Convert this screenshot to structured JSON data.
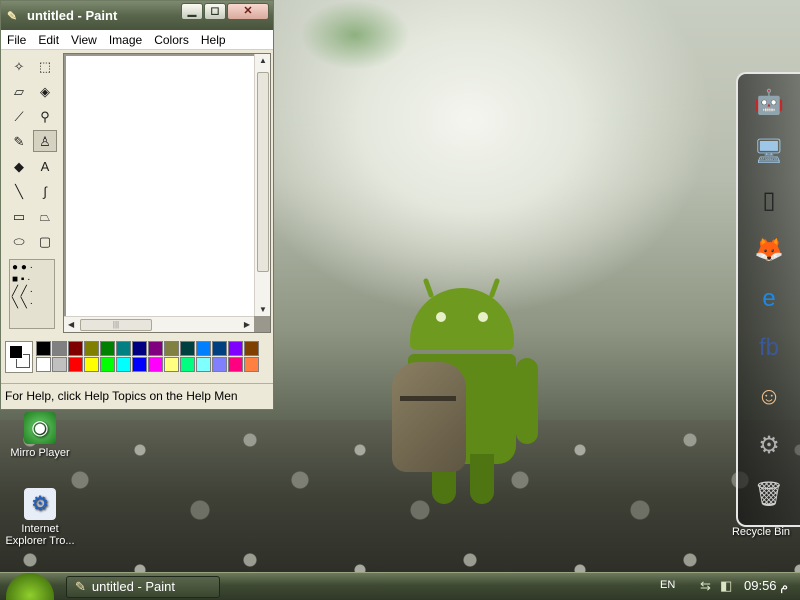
{
  "paint": {
    "title": "untitled - Paint",
    "buttons": {
      "minimize": "▁",
      "maximize": "◻",
      "close": "✕"
    },
    "menu": [
      "File",
      "Edit",
      "View",
      "Image",
      "Colors",
      "Help"
    ],
    "status_text": "For Help, click Help Topics on the Help Men",
    "palette_colors": [
      "#000000",
      "#808080",
      "#800000",
      "#808000",
      "#008000",
      "#008080",
      "#000080",
      "#800080",
      "#808040",
      "#004040",
      "#0080ff",
      "#004080",
      "#8000ff",
      "#804000",
      "#ffffff",
      "#c0c0c0",
      "#ff0000",
      "#ffff00",
      "#00ff00",
      "#00ffff",
      "#0000ff",
      "#ff00ff",
      "#ffff80",
      "#00ff80",
      "#80ffff",
      "#8080ff",
      "#ff0080",
      "#ff8040"
    ],
    "foreground_color": "#000000",
    "background_color": "#ffffff",
    "tools": [
      {
        "name": "free-select-icon",
        "glyph": "✧"
      },
      {
        "name": "rect-select-icon",
        "glyph": "⬚"
      },
      {
        "name": "eraser-icon",
        "glyph": "▱"
      },
      {
        "name": "fill-bucket-icon",
        "glyph": "◈"
      },
      {
        "name": "color-picker-icon",
        "glyph": "⟋"
      },
      {
        "name": "magnifier-icon",
        "glyph": "⚲"
      },
      {
        "name": "pencil-icon",
        "glyph": "✎"
      },
      {
        "name": "brush-icon",
        "glyph": "♙"
      },
      {
        "name": "airbrush-icon",
        "glyph": "◆"
      },
      {
        "name": "text-icon",
        "glyph": "A"
      },
      {
        "name": "line-icon",
        "glyph": "╲"
      },
      {
        "name": "curve-icon",
        "glyph": "∫"
      },
      {
        "name": "rectangle-icon",
        "glyph": "▭"
      },
      {
        "name": "polygon-icon",
        "glyph": "⏢"
      },
      {
        "name": "ellipse-icon",
        "glyph": "⬭"
      },
      {
        "name": "rounded-rect-icon",
        "glyph": "▢"
      }
    ],
    "active_tool": "brush-icon"
  },
  "desktop_icons": [
    {
      "name": "mirro-player-icon",
      "label": "Mirro Player",
      "glyph": "◉"
    },
    {
      "name": "internet-explorer-troubleshooter-icon",
      "label": "Internet Explorer Tro...",
      "glyph": "⚙"
    }
  ],
  "dock": {
    "items": [
      {
        "name": "android-icon",
        "glyph": "🤖",
        "color": "#8bc34a"
      },
      {
        "name": "computer-icon",
        "glyph": "🖥",
        "color": "#9ec6e6"
      },
      {
        "name": "ipad-icon",
        "glyph": "▯",
        "color": "#222222"
      },
      {
        "name": "firefox-icon",
        "glyph": "🦊",
        "color": "#e76a15"
      },
      {
        "name": "ie-icon",
        "glyph": "e",
        "color": "#1e88e5"
      },
      {
        "name": "facebook-icon",
        "glyph": "fb",
        "color": "#3b5998"
      },
      {
        "name": "support-icon",
        "glyph": "☺",
        "color": "#f0c090"
      },
      {
        "name": "settings-icon",
        "glyph": "⚙",
        "color": "#b0b0b0"
      },
      {
        "name": "recycle-bin-icon",
        "glyph": "🗑",
        "color": "#d0d0d0"
      }
    ],
    "recycle_label": "Recycle Bin"
  },
  "taskbar": {
    "task_title": "untitled - Paint",
    "language": "EN",
    "clock": "09:56 م"
  }
}
